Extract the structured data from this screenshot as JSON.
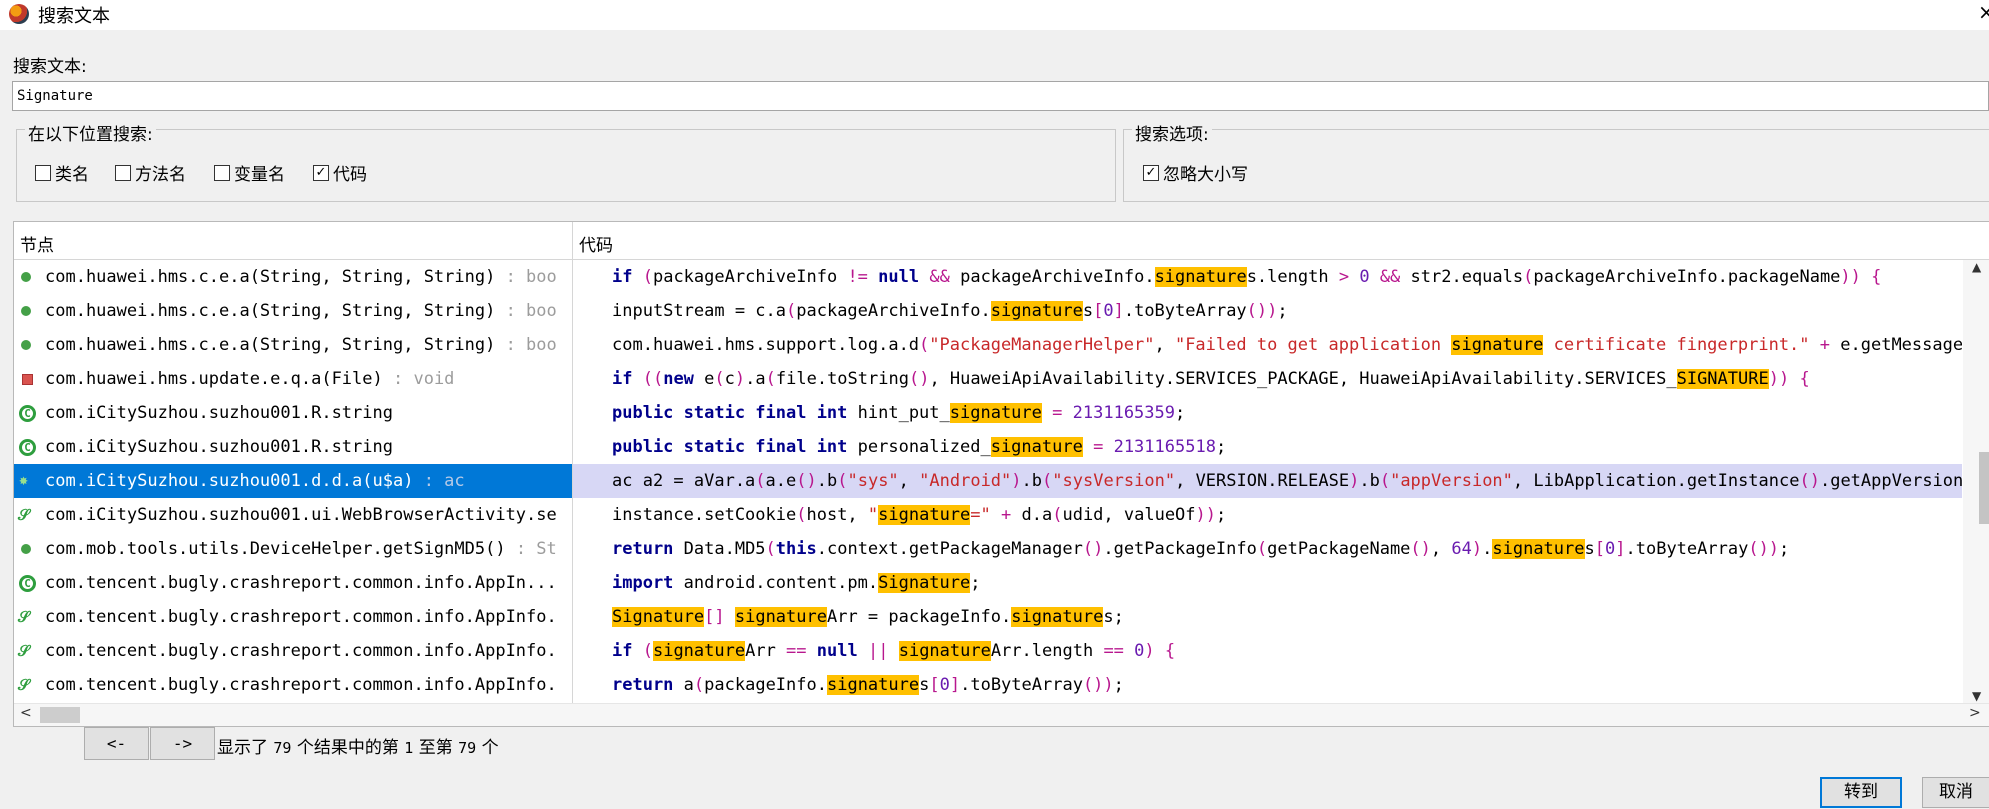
{
  "window": {
    "title": "搜索文本",
    "close_glyph": "×"
  },
  "search": {
    "label": "搜索文本:",
    "value": "Signature"
  },
  "search_in": {
    "legend": "在以下位置搜索:",
    "options": [
      {
        "label": "类名",
        "checked": false
      },
      {
        "label": "方法名",
        "checked": false
      },
      {
        "label": "变量名",
        "checked": false
      },
      {
        "label": "代码",
        "checked": true
      }
    ]
  },
  "search_options": {
    "legend": "搜索选项:",
    "options": [
      {
        "label": "忽略大小写",
        "checked": true
      }
    ]
  },
  "results": {
    "col_nodes": "节点",
    "col_code": "代码",
    "selected_index": 6,
    "nodes": [
      {
        "icon": "method-public-icon",
        "text": "com.huawei.hms.c.e.a(String, String, String)",
        "ret": " : boo"
      },
      {
        "icon": "method-public-icon",
        "text": "com.huawei.hms.c.e.a(String, String, String)",
        "ret": " : boo"
      },
      {
        "icon": "method-public-icon",
        "text": "com.huawei.hms.c.e.a(String, String, String)",
        "ret": " : boo"
      },
      {
        "icon": "method-private-icon",
        "text": "com.huawei.hms.update.e.q.a(File)",
        "ret": " : void"
      },
      {
        "icon": "class-icon",
        "text": "com.iCitySuzhou.suzhou001.R.string",
        "ret": ""
      },
      {
        "icon": "class-icon",
        "text": "com.iCitySuzhou.suzhou001.R.string",
        "ret": ""
      },
      {
        "icon": "method-static-icon",
        "text": "com.iCitySuzhou.suzhou001.d.d.a(u$a)",
        "ret": " : ac"
      },
      {
        "icon": "static-class-icon",
        "text": "com.iCitySuzhou.suzhou001.ui.WebBrowserActivity.se",
        "ret": ""
      },
      {
        "icon": "method-public-icon",
        "text": "com.mob.tools.utils.DeviceHelper.getSignMD5()",
        "ret": " : St"
      },
      {
        "icon": "class-icon",
        "text": "com.tencent.bugly.crashreport.common.info.AppIn...",
        "ret": ""
      },
      {
        "icon": "static-class-icon",
        "text": "com.tencent.bugly.crashreport.common.info.AppInfo.",
        "ret": ""
      },
      {
        "icon": "static-class-icon",
        "text": "com.tencent.bugly.crashreport.common.info.AppInfo.",
        "ret": ""
      },
      {
        "icon": "static-class-icon",
        "text": "com.tencent.bugly.crashreport.common.info.AppInfo.",
        "ret": ""
      }
    ],
    "code_lines": [
      [
        [
          "kw",
          "if"
        ],
        [
          "p",
          " ("
        ],
        [
          "t",
          "packageArchiveInfo "
        ],
        [
          "op",
          "!="
        ],
        [
          "t",
          " "
        ],
        [
          "kw",
          "null"
        ],
        [
          "t",
          " "
        ],
        [
          "op",
          "&&"
        ],
        [
          "t",
          " packageArchiveInfo."
        ],
        [
          "hl",
          "signature"
        ],
        [
          "t",
          "s.length "
        ],
        [
          "op",
          ">"
        ],
        [
          "t",
          " "
        ],
        [
          "num",
          "0"
        ],
        [
          "t",
          " "
        ],
        [
          "op",
          "&&"
        ],
        [
          "t",
          " str2.equals"
        ],
        [
          "p",
          "("
        ],
        [
          "t",
          "packageArchiveInfo.packageName"
        ],
        [
          "p",
          "))"
        ],
        [
          "t",
          " "
        ],
        [
          "p",
          "{"
        ]
      ],
      [
        [
          "t",
          "inputStream = c.a"
        ],
        [
          "p",
          "("
        ],
        [
          "t",
          "packageArchiveInfo."
        ],
        [
          "hl",
          "signature"
        ],
        [
          "t",
          "s"
        ],
        [
          "p",
          "["
        ],
        [
          "num",
          "0"
        ],
        [
          "p",
          "]"
        ],
        [
          "t",
          ".toByteArray"
        ],
        [
          "p",
          "())"
        ],
        [
          "t",
          ";"
        ]
      ],
      [
        [
          "t",
          "com.huawei.hms.support.log.a.d"
        ],
        [
          "p",
          "("
        ],
        [
          "str",
          "\"PackageManagerHelper\""
        ],
        [
          "t",
          ", "
        ],
        [
          "str",
          "\"Failed to get application "
        ],
        [
          "hl",
          "signature"
        ],
        [
          "str",
          " certificate fingerprint.\""
        ],
        [
          "t",
          " "
        ],
        [
          "op",
          "+"
        ],
        [
          "t",
          " e.getMessage"
        ]
      ],
      [
        [
          "kw",
          "if"
        ],
        [
          "p",
          " (("
        ],
        [
          "kw",
          "new"
        ],
        [
          "t",
          " e"
        ],
        [
          "p",
          "("
        ],
        [
          "t",
          "c"
        ],
        [
          "p",
          ")"
        ],
        [
          "t",
          ".a"
        ],
        [
          "p",
          "("
        ],
        [
          "t",
          "file.toString"
        ],
        [
          "p",
          "()"
        ],
        [
          "t",
          ", HuaweiApiAvailability.SERVICES_PACKAGE, HuaweiApiAvailability.SERVICES_"
        ],
        [
          "hl",
          "SIGNATURE"
        ],
        [
          "p",
          "))"
        ],
        [
          "t",
          " "
        ],
        [
          "p",
          "{"
        ]
      ],
      [
        [
          "kw",
          "public static final int"
        ],
        [
          "t",
          " hint_put_"
        ],
        [
          "hl",
          "signature"
        ],
        [
          "t",
          " "
        ],
        [
          "op",
          "="
        ],
        [
          "t",
          " "
        ],
        [
          "num",
          "2131165359"
        ],
        [
          "t",
          ";"
        ]
      ],
      [
        [
          "kw",
          "public static final int"
        ],
        [
          "t",
          " personalized_"
        ],
        [
          "hl",
          "signature"
        ],
        [
          "t",
          " "
        ],
        [
          "op",
          "="
        ],
        [
          "t",
          " "
        ],
        [
          "num",
          "2131165518"
        ],
        [
          "t",
          ";"
        ]
      ],
      [
        [
          "t",
          "ac a2 = aVar.a"
        ],
        [
          "p",
          "("
        ],
        [
          "t",
          "a.e"
        ],
        [
          "p",
          "()"
        ],
        [
          "t",
          ".b"
        ],
        [
          "p",
          "("
        ],
        [
          "str",
          "\"sys\""
        ],
        [
          "t",
          ", "
        ],
        [
          "str",
          "\"Android\""
        ],
        [
          "p",
          ")"
        ],
        [
          "t",
          ".b"
        ],
        [
          "p",
          "("
        ],
        [
          "str",
          "\"sysVersion\""
        ],
        [
          "t",
          ", VERSION.RELEASE"
        ],
        [
          "p",
          ")"
        ],
        [
          "t",
          ".b"
        ],
        [
          "p",
          "("
        ],
        [
          "str",
          "\"appVersion\""
        ],
        [
          "t",
          ", LibApplication.getInstance"
        ],
        [
          "p",
          "()"
        ],
        [
          "t",
          ".getAppVersion"
        ]
      ],
      [
        [
          "t",
          "instance.setCookie"
        ],
        [
          "p",
          "("
        ],
        [
          "t",
          "host, "
        ],
        [
          "str",
          "\""
        ],
        [
          "hl",
          "signature"
        ],
        [
          "str",
          "=\""
        ],
        [
          "t",
          " "
        ],
        [
          "op",
          "+"
        ],
        [
          "t",
          " d.a"
        ],
        [
          "p",
          "("
        ],
        [
          "t",
          "udid, valueOf"
        ],
        [
          "p",
          "))"
        ],
        [
          "t",
          ";"
        ]
      ],
      [
        [
          "kw",
          "return"
        ],
        [
          "t",
          " Data.MD5"
        ],
        [
          "p",
          "("
        ],
        [
          "kw",
          "this"
        ],
        [
          "t",
          ".context.getPackageManager"
        ],
        [
          "p",
          "()"
        ],
        [
          "t",
          ".getPackageInfo"
        ],
        [
          "p",
          "("
        ],
        [
          "t",
          "getPackageName"
        ],
        [
          "p",
          "()"
        ],
        [
          "t",
          ", "
        ],
        [
          "num",
          "64"
        ],
        [
          "p",
          ")"
        ],
        [
          "t",
          "."
        ],
        [
          "hl",
          "signature"
        ],
        [
          "t",
          "s"
        ],
        [
          "p",
          "["
        ],
        [
          "num",
          "0"
        ],
        [
          "p",
          "]"
        ],
        [
          "t",
          ".toByteArray"
        ],
        [
          "p",
          "())"
        ],
        [
          "t",
          ";"
        ]
      ],
      [
        [
          "kw",
          "import"
        ],
        [
          "t",
          " android.content.pm."
        ],
        [
          "hl",
          "Signature"
        ],
        [
          "t",
          ";"
        ]
      ],
      [
        [
          "hl",
          "Signature"
        ],
        [
          "p",
          "[]"
        ],
        [
          "t",
          " "
        ],
        [
          "hl",
          "signature"
        ],
        [
          "t",
          "Arr = packageInfo."
        ],
        [
          "hl",
          "signature"
        ],
        [
          "t",
          "s;"
        ]
      ],
      [
        [
          "kw",
          "if"
        ],
        [
          "p",
          " ("
        ],
        [
          "hl",
          "signature"
        ],
        [
          "t",
          "Arr "
        ],
        [
          "op",
          "=="
        ],
        [
          "t",
          " "
        ],
        [
          "kw",
          "null"
        ],
        [
          "t",
          " "
        ],
        [
          "op",
          "||"
        ],
        [
          "t",
          " "
        ],
        [
          "hl",
          "signature"
        ],
        [
          "t",
          "Arr.length "
        ],
        [
          "op",
          "=="
        ],
        [
          "t",
          " "
        ],
        [
          "num",
          "0"
        ],
        [
          "p",
          ")"
        ],
        [
          "t",
          " "
        ],
        [
          "p",
          "{"
        ]
      ],
      [
        [
          "kw",
          "return"
        ],
        [
          "t",
          " a"
        ],
        [
          "p",
          "("
        ],
        [
          "t",
          "packageInfo."
        ],
        [
          "hl",
          "signature"
        ],
        [
          "t",
          "s"
        ],
        [
          "p",
          "["
        ],
        [
          "num",
          "0"
        ],
        [
          "p",
          "]"
        ],
        [
          "t",
          ".toByteArray"
        ],
        [
          "p",
          "())"
        ],
        [
          "t",
          ";"
        ]
      ]
    ]
  },
  "nav": {
    "prev": "<-",
    "next": "->"
  },
  "status": {
    "prefix": "显示了",
    "total": "79",
    "mid1": "个结果中的第",
    "from": "1",
    "mid2": "至第",
    "to": "79",
    "suffix": "个"
  },
  "buttons": {
    "goto": "转到",
    "cancel": "取消"
  },
  "colors": {
    "selection": "#0078d7",
    "code_selection": "#d7d7f5",
    "highlight": "#ffc000",
    "keyword": "#00008b",
    "string": "#c82829",
    "number": "#6a1bb0"
  }
}
